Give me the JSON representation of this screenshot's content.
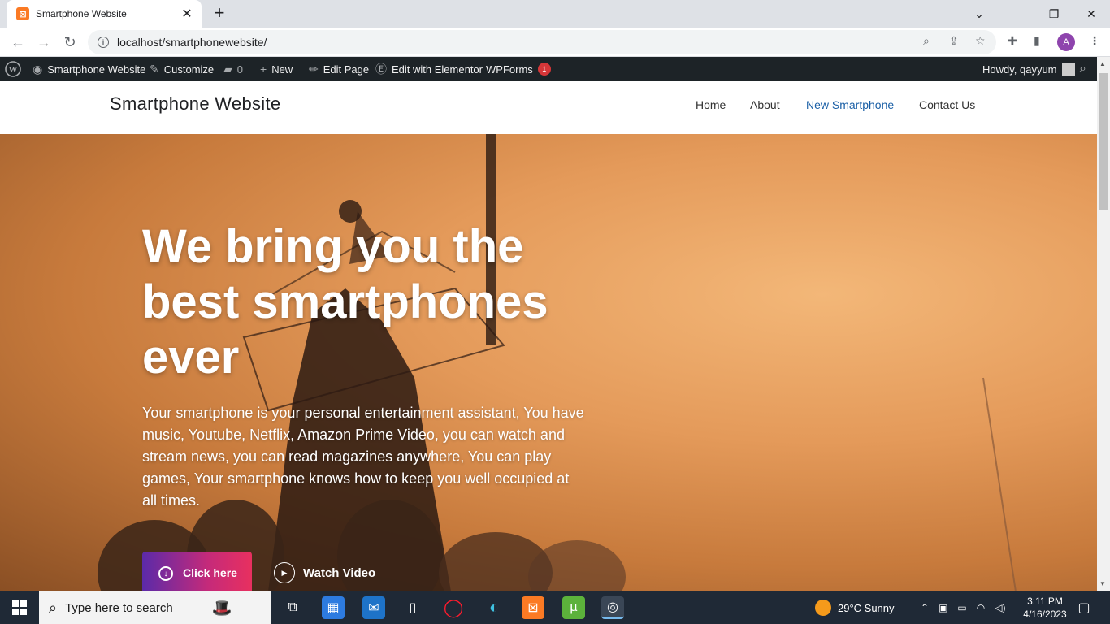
{
  "browser": {
    "tab_title": "Smartphone Website",
    "url": "localhost/smartphonewebsite/",
    "profile_initial": "A"
  },
  "wpbar": {
    "site_name": "Smartphone Website",
    "customize": "Customize",
    "comments_count": "0",
    "new": "New",
    "edit_page": "Edit Page",
    "elementor": "Edit with Elementor",
    "wpforms": "WPForms",
    "wpforms_badge": "1",
    "greeting": "Howdy, qayyum"
  },
  "site": {
    "title": "Smartphone Website",
    "menu": [
      "Home",
      "About",
      "New Smartphone",
      "Contact Us"
    ]
  },
  "hero": {
    "heading": "We bring you the best smartphones ever",
    "paragraph": "Your smartphone is your personal entertainment assistant, You have music, Youtube, Netflix, Amazon Prime Video, you can watch and stream news, you can read magazines anywhere, You can play games, Your smartphone knows how to keep you well occupied at all times.",
    "primary_button": "Click here",
    "video_button": "Watch Video"
  },
  "taskbar": {
    "search_placeholder": "Type here to search",
    "weather": "29°C  Sunny",
    "time": "3:11 PM",
    "date": "4/16/2023"
  },
  "colors": {
    "accent_link": "#1a5fa6",
    "wpbar_bg": "#1d2327",
    "button_gradient_start": "#5b2aa8",
    "button_gradient_end": "#e8305f"
  }
}
